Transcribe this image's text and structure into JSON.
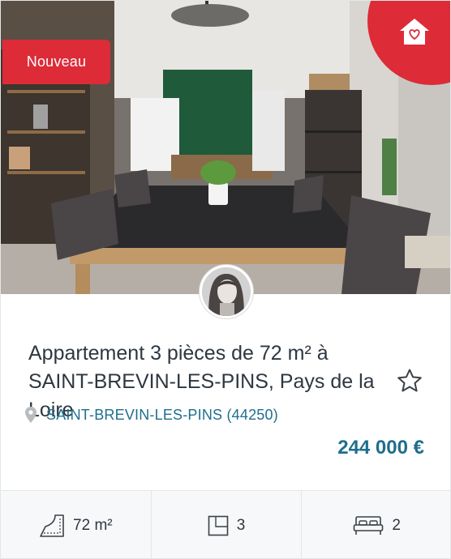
{
  "listing": {
    "badge": "Nouveau",
    "title": "Appartement 3 pièces de 72 m² à SAINT-BREVIN-LES-PINS, Pays de la Loire",
    "location": "SAINT-BREVIN-LES-PINS (44250)",
    "price": "244 000 €"
  },
  "features": {
    "surface": "72 m²",
    "rooms": "3",
    "bedrooms": "2"
  },
  "icons": {
    "favorite": "house-heart-icon",
    "star": "star-icon",
    "location": "map-pin-icon",
    "surface": "surface-area-icon",
    "rooms": "floor-plan-icon",
    "bedrooms": "bed-icon"
  },
  "colors": {
    "accent_red": "#dd2b38",
    "accent_blue": "#1f6e8c",
    "text_dark": "#2e3740"
  }
}
